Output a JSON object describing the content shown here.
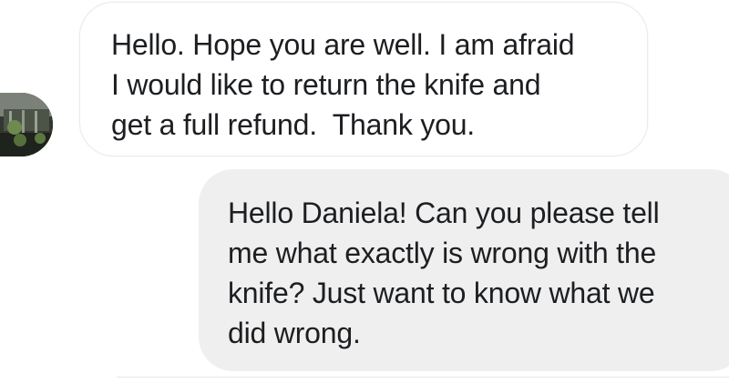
{
  "conversation": {
    "incoming": {
      "sender_avatar": "profile-photo",
      "lines": [
        "Hello. Hope you are well. I am afraid",
        "I would like to return the knife and",
        "get a full refund.  Thank you."
      ]
    },
    "outgoing": {
      "lines": [
        "Hello Daniela! Can you please tell",
        "me what exactly is wrong with the",
        "knife? Just want to know what we",
        "did wrong."
      ]
    }
  },
  "colors": {
    "incoming_bubble": "#ffffff",
    "outgoing_bubble": "#efefef",
    "text": "#1c1e21"
  }
}
